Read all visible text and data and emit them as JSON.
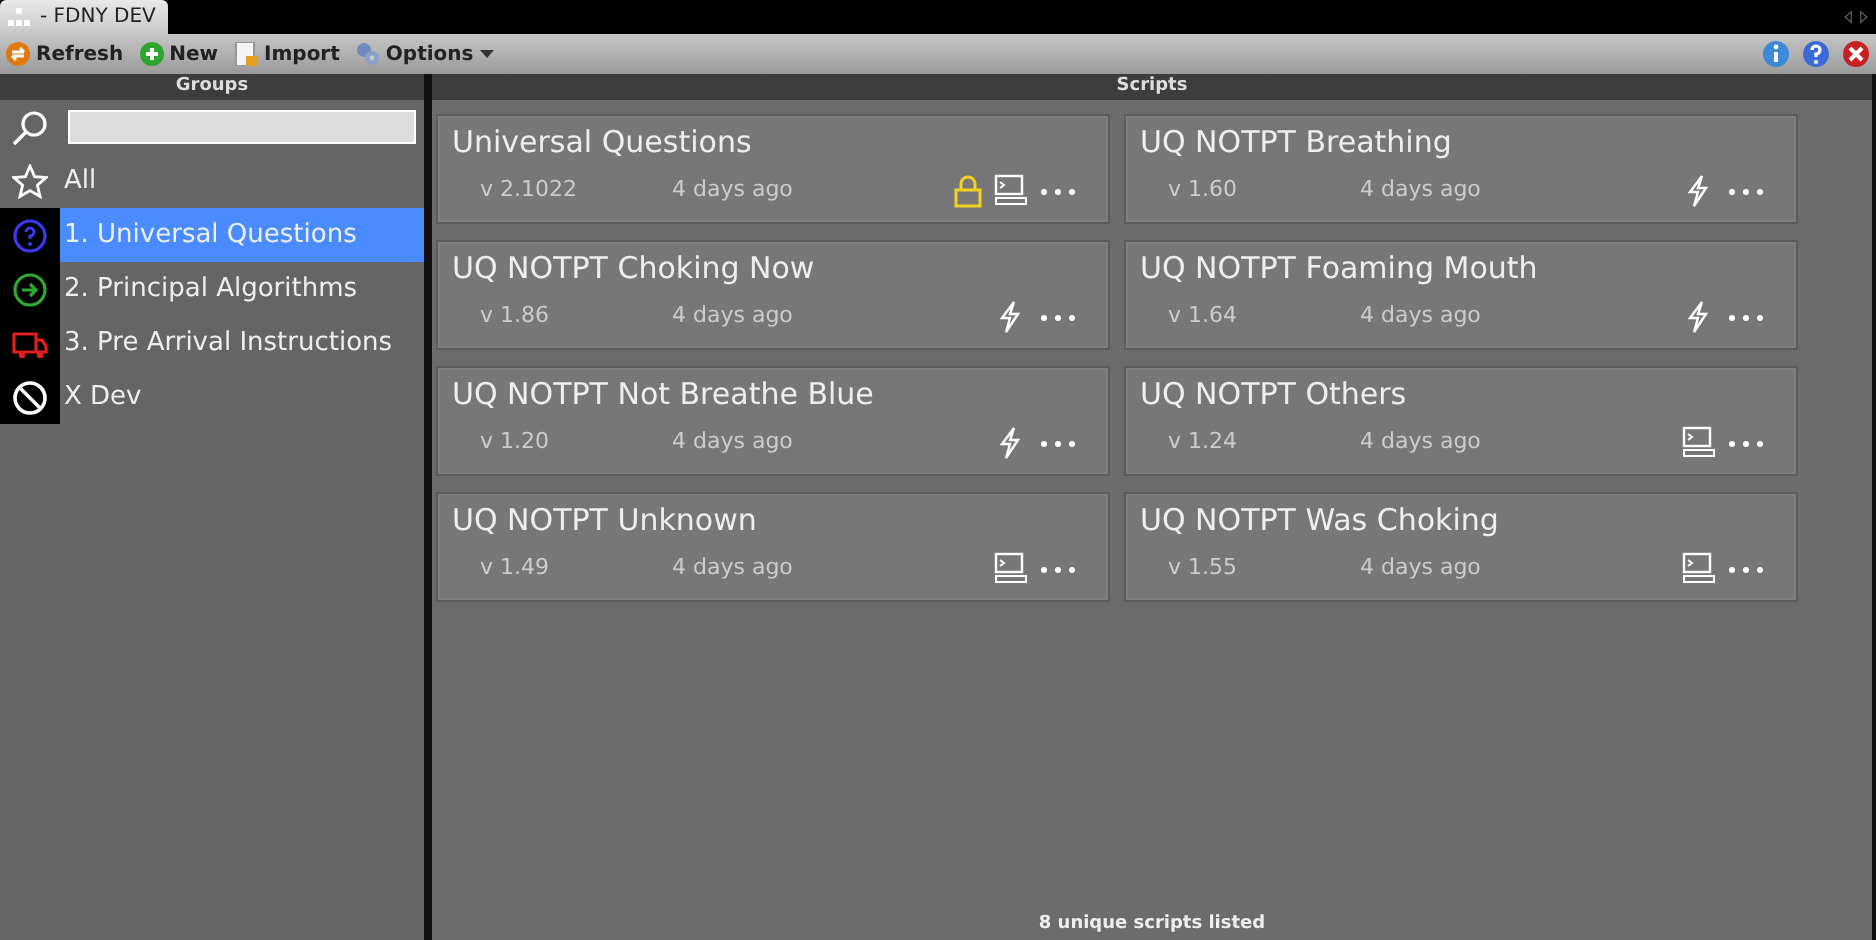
{
  "window": {
    "title": "- FDNY DEV"
  },
  "toolbar": [
    {
      "label": "Refresh",
      "kind": "refresh"
    },
    {
      "label": "New",
      "kind": "new"
    },
    {
      "label": "Import",
      "kind": "import"
    },
    {
      "label": "Options",
      "kind": "options",
      "dropdown": true
    }
  ],
  "groups": {
    "title": "Groups",
    "items": [
      {
        "label": "All",
        "kind": "star",
        "selected": false
      },
      {
        "label": "1. Universal Questions",
        "kind": "question",
        "selected": true
      },
      {
        "label": "2. Principal Algorithms",
        "kind": "arrow",
        "selected": false
      },
      {
        "label": "3. Pre Arrival Instructions",
        "kind": "truck",
        "selected": false
      },
      {
        "label": "X Dev",
        "kind": "ban",
        "selected": false
      }
    ]
  },
  "scripts": {
    "title": "Scripts",
    "cards": [
      {
        "name": "Universal Questions",
        "version": "v 2.1022",
        "updated": "4 days ago",
        "locked": true,
        "kind": "terminal"
      },
      {
        "name": "UQ NOTPT Breathing",
        "version": "v 1.60",
        "updated": "4 days ago",
        "locked": false,
        "kind": "lightning"
      },
      {
        "name": "UQ NOTPT Choking Now",
        "version": "v 1.86",
        "updated": "4 days ago",
        "locked": false,
        "kind": "lightning"
      },
      {
        "name": "UQ NOTPT Foaming Mouth",
        "version": "v 1.64",
        "updated": "4 days ago",
        "locked": false,
        "kind": "lightning"
      },
      {
        "name": "UQ NOTPT Not Breathe Blue",
        "version": "v 1.20",
        "updated": "4 days ago",
        "locked": false,
        "kind": "lightning"
      },
      {
        "name": "UQ NOTPT Others",
        "version": "v 1.24",
        "updated": "4 days ago",
        "locked": false,
        "kind": "terminal"
      },
      {
        "name": "UQ NOTPT Unknown",
        "version": "v 1.49",
        "updated": "4 days ago",
        "locked": false,
        "kind": "terminal"
      },
      {
        "name": "UQ NOTPT Was Choking",
        "version": "v 1.55",
        "updated": "4 days ago",
        "locked": false,
        "kind": "terminal"
      }
    ],
    "status": "8 unique scripts listed"
  }
}
